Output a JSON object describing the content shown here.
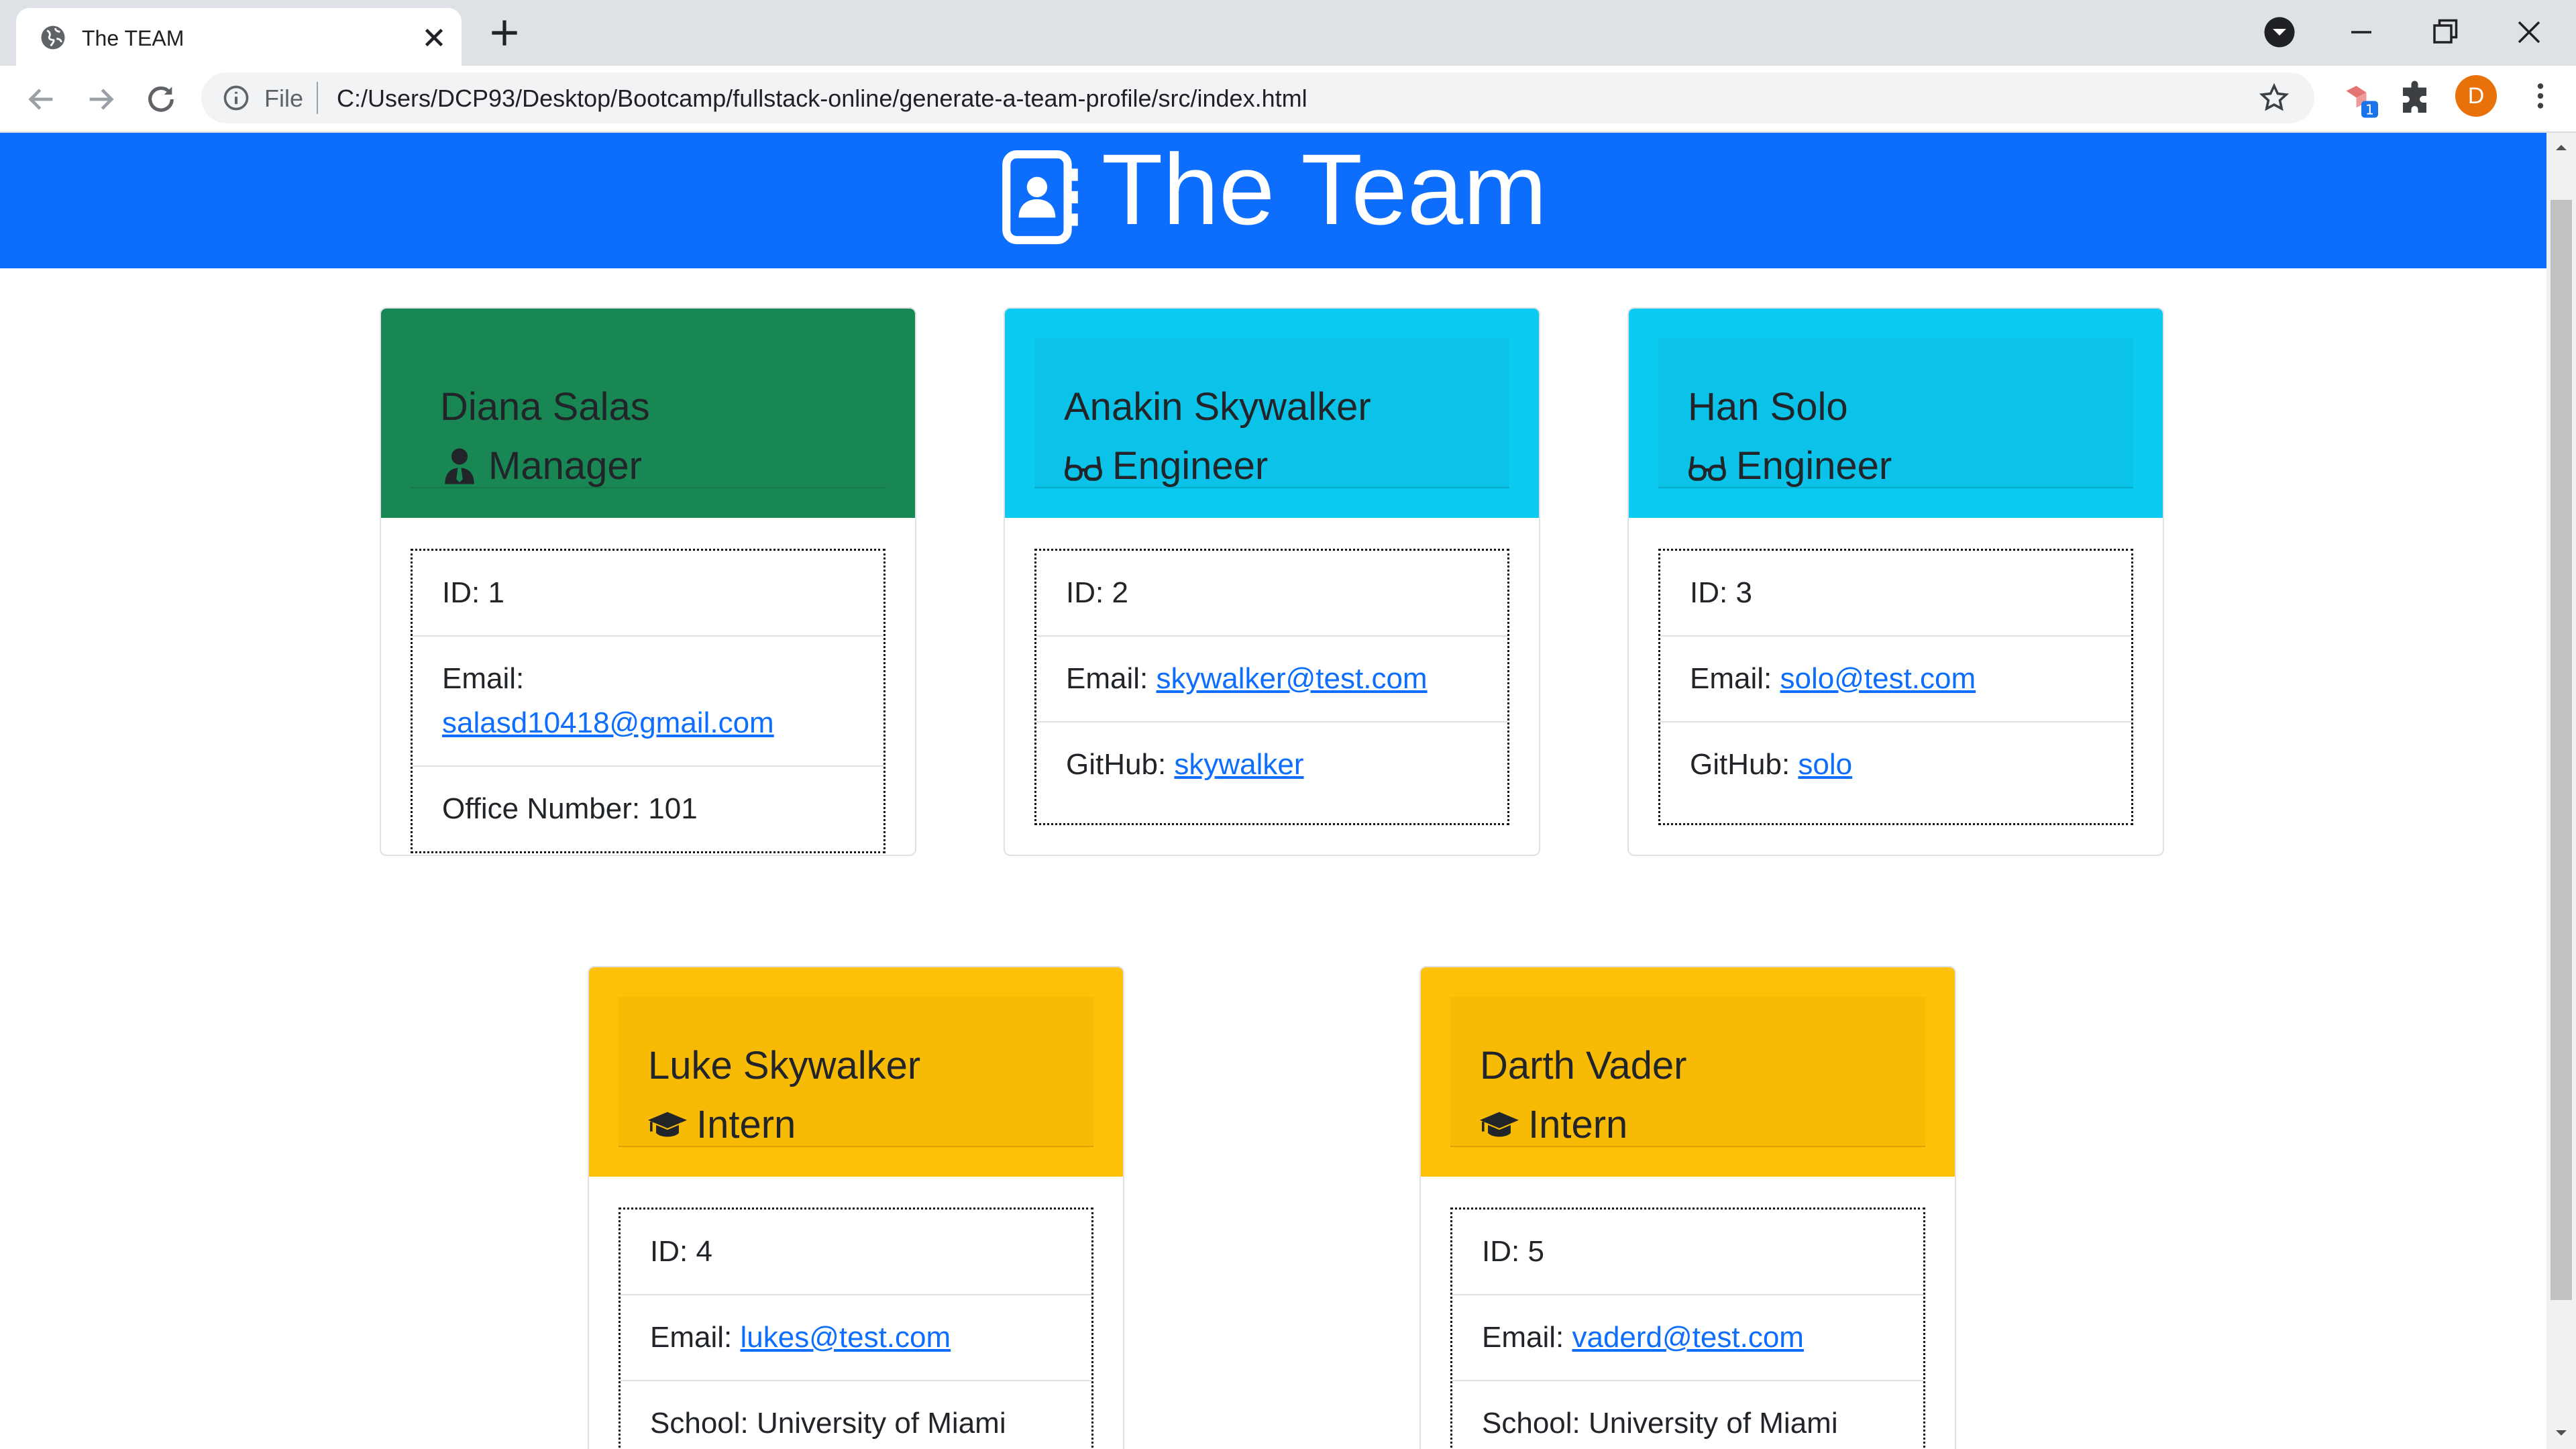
{
  "browser": {
    "tab_title": "The TEAM",
    "address_scheme": "File",
    "url": "C:/Users/DCP93/Desktop/Bootcamp/fullstack-online/generate-a-team-profile/src/index.html",
    "profile_initial": "D",
    "extension_badge": "1"
  },
  "header": {
    "title": "The Team"
  },
  "team": [
    {
      "name": "Diana Salas",
      "role": "Manager",
      "role_icon": "user-tie-icon",
      "color": "#198754",
      "id": "ID: 1",
      "email_label": "Email:",
      "email": "salasd10418@gmail.com",
      "extra_label": "Office Number: 101",
      "extra_link": ""
    },
    {
      "name": "Anakin Skywalker",
      "role": "Engineer",
      "role_icon": "glasses-icon",
      "color": "#0dcaf0",
      "id": "ID: 2",
      "email_label": "Email:",
      "email": "skywalker@test.com",
      "extra_label": "GitHub:",
      "extra_link": "skywalker"
    },
    {
      "name": "Han Solo",
      "role": "Engineer",
      "role_icon": "glasses-icon",
      "color": "#0dcaf0",
      "id": "ID: 3",
      "email_label": "Email:",
      "email": "solo@test.com",
      "extra_label": "GitHub:",
      "extra_link": "solo"
    },
    {
      "name": "Luke Skywalker",
      "role": "Intern",
      "role_icon": "graduation-cap-icon",
      "color": "#ffc107",
      "id": "ID: 4",
      "email_label": "Email:",
      "email": "lukes@test.com",
      "extra_label": "School: University of Miami",
      "extra_link": ""
    },
    {
      "name": "Darth Vader",
      "role": "Intern",
      "role_icon": "graduation-cap-icon",
      "color": "#ffc107",
      "id": "ID: 5",
      "email_label": "Email:",
      "email": "vaderd@test.com",
      "extra_label": "School: University of Miami",
      "extra_link": ""
    }
  ]
}
